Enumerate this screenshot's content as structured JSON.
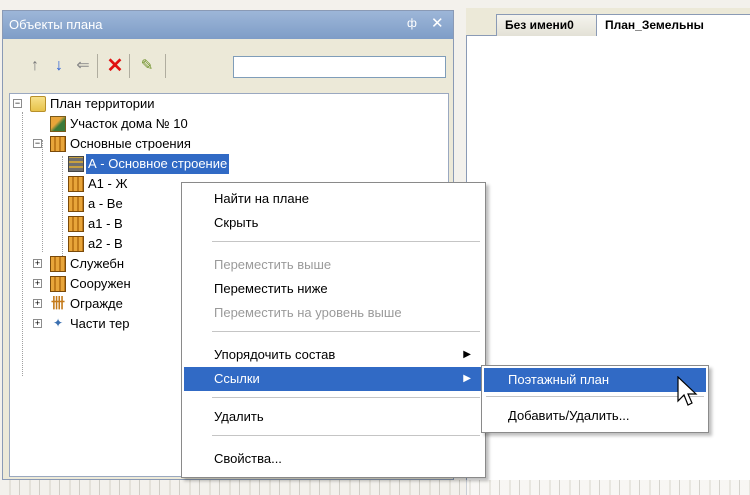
{
  "panel": {
    "title": "Объекты плана",
    "pin_glyph": "ф",
    "close_glyph": "✕",
    "search_value": "",
    "search_placeholder": ""
  },
  "toolbar": {
    "icons": [
      "arrow-up-icon",
      "arrow-down-icon",
      "arrow-left-icon",
      "delete-icon",
      "properties-icon"
    ]
  },
  "tree": {
    "root": "План территории",
    "plot": "Участок дома № 10",
    "main_buildings": "Основные строения",
    "selected": "А - Основное строение",
    "child_a1": "А1 - Ж",
    "child_a": "а - Ве",
    "child_a1_small": "а1 - В",
    "child_a2": "а2 - В",
    "service": "Служебн",
    "structures": "Сооружен",
    "fences": "Огражде",
    "parts": "Части тер"
  },
  "doc_tabs": [
    "Без имени0",
    "План_Земельны"
  ],
  "context_menu": {
    "find": "Найти на плане",
    "hide": "Скрыть",
    "move_up": "Переместить выше",
    "move_down": "Переместить ниже",
    "move_level_up": "Переместить на уровень выше",
    "arrange": "Упорядочить состав",
    "links": "Ссылки",
    "delete": "Удалить",
    "properties": "Свойства..."
  },
  "submenu": {
    "floor_plan": "Поэтажный план",
    "add_remove": "Добавить/Удалить..."
  },
  "colors": {
    "selection": "#316ac5",
    "header": "#7e9dc7"
  }
}
